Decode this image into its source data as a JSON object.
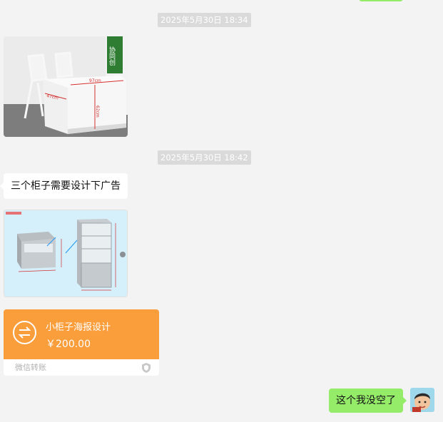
{
  "timestamps": [
    "2025年5月30日 18:34",
    "2025年5月30日 18:42"
  ],
  "photo1": {
    "sign_text": "协同创",
    "dim_width": "97cm",
    "dim_depth": "47cm",
    "dim_height": "62cm"
  },
  "message_text": "三个柜子需要设计下广告",
  "transfer": {
    "title": "小柜子海报设计",
    "amount": "￥200.00",
    "footer": "微信转账",
    "color": "#fa9d3b"
  },
  "reply": "这个我没空了",
  "colors": {
    "bubble_green": "#95ec69",
    "background": "#f3f3f3"
  }
}
